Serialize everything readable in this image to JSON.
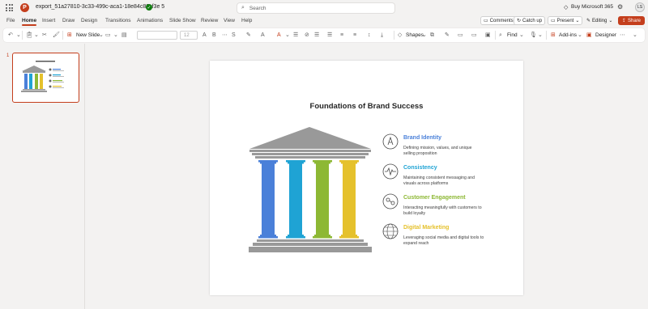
{
  "titlebar": {
    "doc_title": "export_51a27810-3c33-499c-aca1-18e84c88cf3e 5",
    "search_placeholder": "Search",
    "buy_label": "Buy Microsoft 365",
    "avatar_initials": "LS"
  },
  "menu": {
    "tabs": [
      "File",
      "Home",
      "Insert",
      "Draw",
      "Design",
      "Transitions",
      "Animations",
      "Slide Show",
      "Review",
      "View",
      "Help"
    ],
    "active_tab": "Home",
    "comments_label": "Comments",
    "catchup_label": "Catch up",
    "present_label": "Present",
    "editing_label": "Editing",
    "share_label": "Share"
  },
  "ribbon": {
    "new_slide_label": "New Slide",
    "font_size": "12",
    "shapes_label": "Shapes",
    "find_label": "Find",
    "addins_label": "Add-ins",
    "designer_label": "Designer"
  },
  "thumbnails": {
    "slide_number": "1"
  },
  "slide": {
    "title": "Foundations of Brand Success",
    "items": [
      {
        "title": "Brand Identity",
        "desc": "Defining mission, values, and unique selling proposition",
        "color": "#4a80d9",
        "icon": "identity-icon"
      },
      {
        "title": "Consistency",
        "desc": "Maintaining consistent messaging and visuals across platforms",
        "color": "#1fa3d4",
        "icon": "pulse-icon"
      },
      {
        "title": "Customer Engagement",
        "desc": "Interacting meaningfully with customers to build loyalty",
        "color": "#8db834",
        "icon": "engagement-icon"
      },
      {
        "title": "Digital Marketing",
        "desc": "Leveraging social media and digital tools to expand reach",
        "color": "#e5c12c",
        "icon": "globe-icon"
      }
    ],
    "temple_gray": "#999999"
  },
  "colors": {
    "accent": "#c43e1c"
  }
}
